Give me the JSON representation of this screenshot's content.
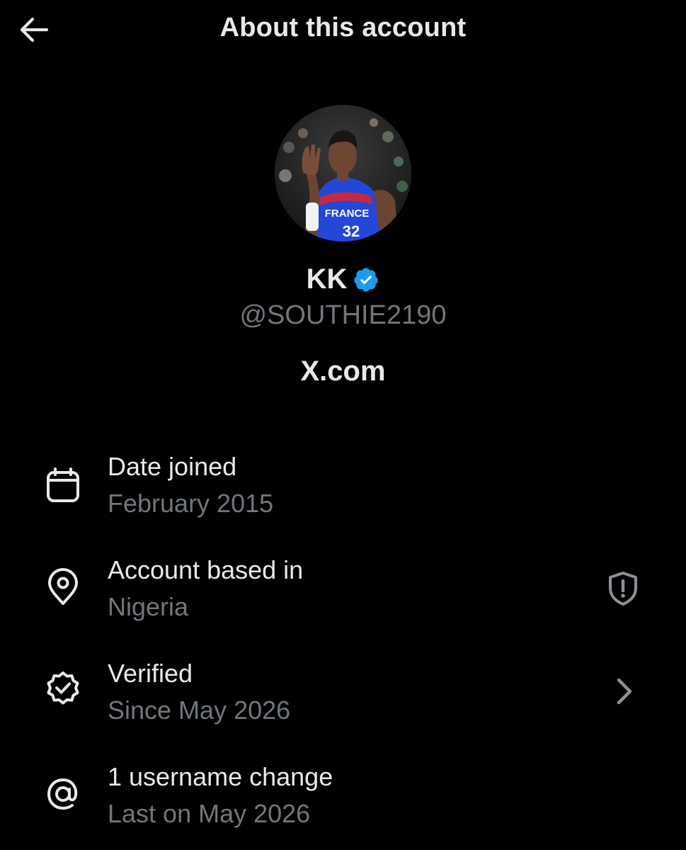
{
  "header": {
    "title": "About this account",
    "back_icon": "arrow-left-icon"
  },
  "profile": {
    "display_name": "KK",
    "verified": true,
    "verified_color": "#1d9bf0",
    "handle": "@SOUTHIE2190",
    "site": "X.com",
    "avatar_jersey_text": "FRANCE",
    "avatar_jersey_number": "32"
  },
  "rows": [
    {
      "icon": "calendar-icon",
      "title": "Date joined",
      "subtitle": "February 2015"
    },
    {
      "icon": "location-pin-icon",
      "title": "Account based in",
      "subtitle": "Nigeria",
      "trailing_icon": "shield-alert-icon"
    },
    {
      "icon": "verified-badge-outline-icon",
      "title": "Verified",
      "subtitle": "Since May 2026",
      "trailing_icon": "chevron-right-icon"
    },
    {
      "icon": "at-sign-icon",
      "title": "1 username change",
      "subtitle": "Last on May 2026"
    }
  ],
  "colors": {
    "background": "#000000",
    "primary_text": "#e7e9ea",
    "secondary_text": "#71767b"
  }
}
